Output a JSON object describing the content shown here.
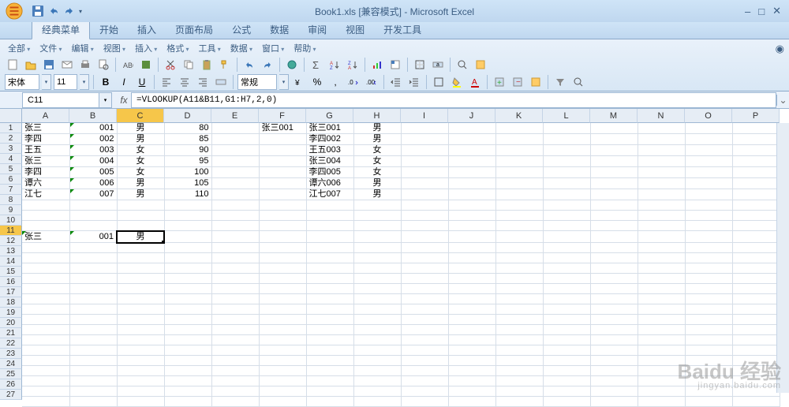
{
  "title": {
    "filename": "Book1.xls",
    "mode": "[兼容模式]",
    "app": "Microsoft Excel"
  },
  "tabs": [
    "经典菜单",
    "开始",
    "插入",
    "页面布局",
    "公式",
    "数据",
    "审阅",
    "视图",
    "开发工具"
  ],
  "menu": [
    "全部",
    "文件",
    "编辑",
    "视图",
    "插入",
    "格式",
    "工具",
    "数据",
    "窗口",
    "帮助"
  ],
  "font": {
    "name": "宋体",
    "size": "11"
  },
  "style_combo": "常规",
  "namebox": "C11",
  "formula": "=VLOOKUP(A11&B11,G1:H7,2,0)",
  "columns": [
    "A",
    "B",
    "C",
    "D",
    "E",
    "F",
    "G",
    "H",
    "I",
    "J",
    "K",
    "L",
    "M",
    "N",
    "O",
    "P"
  ],
  "rows": [
    "1",
    "2",
    "3",
    "4",
    "5",
    "6",
    "7",
    "8",
    "9",
    "10",
    "11",
    "12",
    "13",
    "14",
    "15",
    "16",
    "17",
    "18",
    "19",
    "20",
    "21",
    "22",
    "23",
    "24",
    "25",
    "26",
    "27"
  ],
  "data": {
    "A": [
      "张三",
      "李四",
      "王五",
      "张三",
      "李四",
      "谭六",
      "江七",
      "",
      "",
      "",
      "张三"
    ],
    "B": [
      "001",
      "002",
      "003",
      "004",
      "005",
      "006",
      "007",
      "",
      "",
      "",
      "001"
    ],
    "C": [
      "男",
      "男",
      "女",
      "女",
      "女",
      "男",
      "男",
      "",
      "",
      "",
      "男"
    ],
    "D": [
      "80",
      "85",
      "90",
      "95",
      "100",
      "105",
      "110"
    ],
    "F": [
      "张三001"
    ],
    "G": [
      "张三001",
      "李四002",
      "王五003",
      "张三004",
      "李四005",
      "谭六006",
      "江七007"
    ],
    "H": [
      "男",
      "男",
      "女",
      "女",
      "女",
      "男",
      "男"
    ]
  },
  "watermark": {
    "main": "Baidu 经验",
    "sub": "jingyan.baidu.com"
  }
}
